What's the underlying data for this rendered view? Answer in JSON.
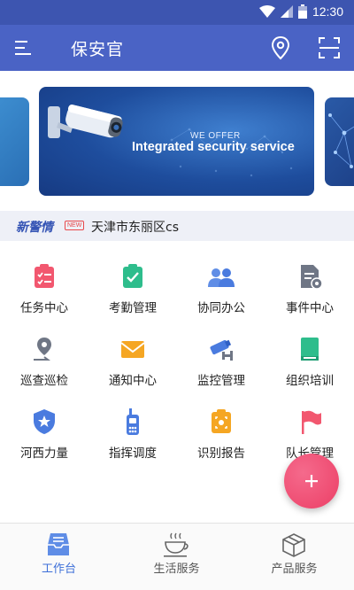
{
  "status_bar": {
    "time": "12:30"
  },
  "app_bar": {
    "title": "保安官"
  },
  "banner": {
    "small_text": "WE OFFER",
    "big_text": "Integrated security service"
  },
  "news": {
    "brand": "新警情",
    "badge": "NEW",
    "text": "天津市东丽区cs"
  },
  "grid": {
    "items": [
      {
        "label": "任务中心",
        "icon": "task-center-icon"
      },
      {
        "label": "考勤管理",
        "icon": "attendance-icon"
      },
      {
        "label": "协同办公",
        "icon": "collaboration-icon"
      },
      {
        "label": "事件中心",
        "icon": "event-center-icon"
      },
      {
        "label": "巡查巡检",
        "icon": "patrol-icon"
      },
      {
        "label": "通知中心",
        "icon": "notification-icon"
      },
      {
        "label": "监控管理",
        "icon": "monitor-icon"
      },
      {
        "label": "组织培训",
        "icon": "training-icon"
      },
      {
        "label": "河西力量",
        "icon": "shield-icon"
      },
      {
        "label": "指挥调度",
        "icon": "walkie-talkie-icon"
      },
      {
        "label": "识别报告",
        "icon": "recognition-report-icon"
      },
      {
        "label": "队长管理",
        "icon": "flag-icon"
      }
    ]
  },
  "tabs": [
    {
      "label": "工作台",
      "active": true
    },
    {
      "label": "生活服务",
      "active": false
    },
    {
      "label": "产品服务",
      "active": false
    }
  ],
  "colors": {
    "app_bar": "#4a63c5",
    "accent": "#3d6fd8",
    "fab": "#ec3f66"
  }
}
